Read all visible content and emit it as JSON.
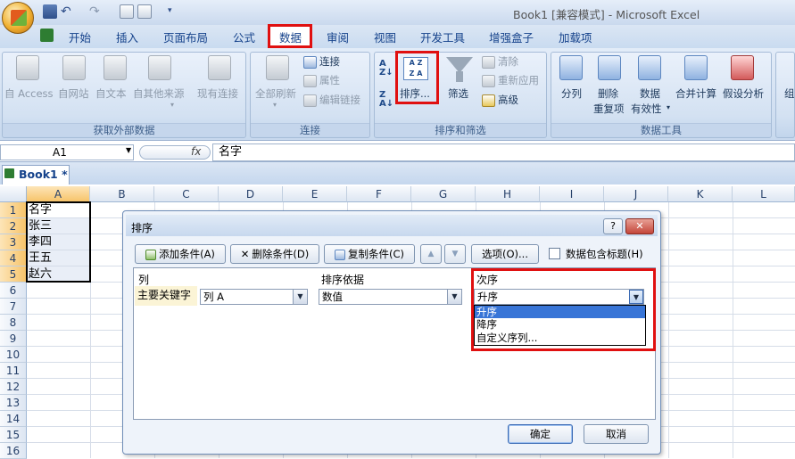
{
  "window": {
    "title": "Book1  [兼容模式] - Microsoft Excel"
  },
  "ribbon_tabs": [
    "开始",
    "插入",
    "页面布局",
    "公式",
    "数据",
    "审阅",
    "视图",
    "开发工具",
    "增强盒子",
    "加载项"
  ],
  "groups": {
    "external": {
      "label": "获取外部数据",
      "items": [
        "自 Access",
        "自网站",
        "自文本",
        "自其他来源",
        "现有连接"
      ]
    },
    "connections": {
      "label": "连接",
      "refresh": "全部刷新",
      "items": [
        "连接",
        "属性",
        "编辑链接"
      ]
    },
    "sortfilter": {
      "label": "排序和筛选",
      "sort": "排序...",
      "filter": "筛选",
      "clear": "清除",
      "reapply": "重新应用",
      "advanced": "高级"
    },
    "datatools": {
      "label": "数据工具",
      "split": "分列",
      "dedupe1": "删除",
      "dedupe2": "重复项",
      "valid1": "数据",
      "valid2": "有效性",
      "consolidate": "合并计算",
      "whatif": "假设分析",
      "group": "组"
    }
  },
  "formula_bar": {
    "name_box": "A1",
    "fx": "fx",
    "value": "名字"
  },
  "workbook_tab": "Book1 *",
  "columns": [
    "A",
    "B",
    "C",
    "D",
    "E",
    "F",
    "G",
    "H",
    "I",
    "J",
    "K",
    "L"
  ],
  "rows": [
    "1",
    "2",
    "3",
    "4",
    "5",
    "6",
    "7",
    "8",
    "9",
    "10",
    "11",
    "12",
    "13",
    "14",
    "15",
    "16"
  ],
  "cells_a": [
    "名字",
    "张三",
    "李四",
    "王五",
    "赵六"
  ],
  "dialog": {
    "title": "排序",
    "help": "?",
    "close": "✕",
    "add_level": "添加条件(A)",
    "delete_level": "删除条件(D)",
    "copy_level": "复制条件(C)",
    "options": "选项(O)...",
    "headers_checkbox": "数据包含标题(H)",
    "col_header": "列",
    "sort_on_header": "排序依据",
    "order_header": "次序",
    "primary_key": "主要关键字",
    "column_value": "列 A",
    "sort_on_value": "数值",
    "order_value": "升序",
    "order_options": [
      "升序",
      "降序",
      "自定义序列..."
    ],
    "ok": "确定",
    "cancel": "取消"
  },
  "colors": {
    "highlight": "#e01010",
    "ribbon_text": "#1e395b",
    "tab_text": "#15428b"
  }
}
